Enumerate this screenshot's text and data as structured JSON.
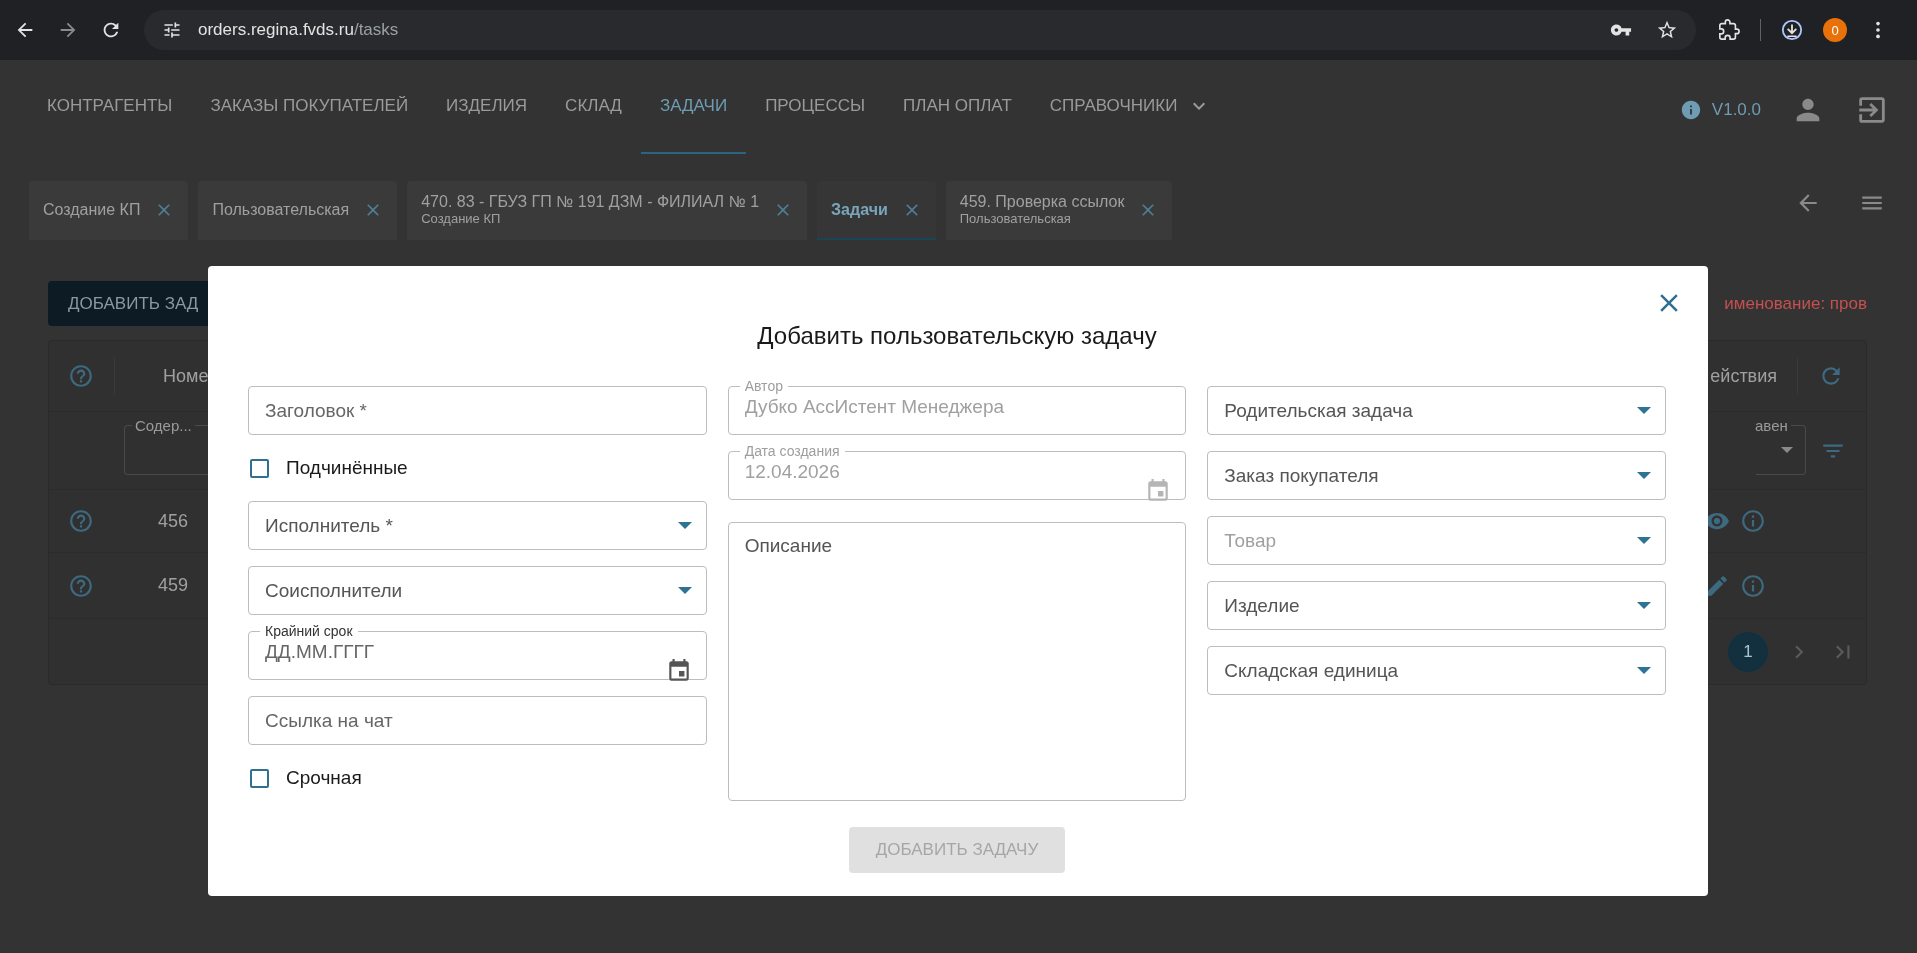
{
  "browser": {
    "url_host": "orders.regina.fvds.ru",
    "url_path": "/tasks",
    "profile": "0"
  },
  "nav": {
    "items": [
      {
        "label": "КОНТРАГЕНТЫ",
        "selected": false,
        "kind": "link"
      },
      {
        "label": "ЗАКАЗЫ ПОКУПАТЕЛЕЙ",
        "selected": false,
        "kind": "link"
      },
      {
        "label": "ИЗДЕЛИЯ",
        "selected": false,
        "kind": "link"
      },
      {
        "label": "СКЛАД",
        "selected": false,
        "kind": "link"
      },
      {
        "label": "ЗАДАЧИ",
        "selected": true,
        "kind": "link"
      },
      {
        "label": "ПРОЦЕССЫ",
        "selected": false,
        "kind": "link"
      },
      {
        "label": "ПЛАН ОПЛАТ",
        "selected": false,
        "kind": "link"
      },
      {
        "label": "СПРАВОЧНИКИ",
        "selected": false,
        "kind": "menu"
      }
    ],
    "version": "V1.0.0"
  },
  "tabs": [
    {
      "title": "Создание КП",
      "selected": false
    },
    {
      "title": "Пользовательская",
      "selected": false
    },
    {
      "title": "470. 83 - ГБУЗ ГП № 191 ДЗМ - ФИЛИАЛ № 1",
      "subtitle": "Создание КП",
      "selected": false
    },
    {
      "title": "Задачи",
      "selected": true
    },
    {
      "title": "459. Проверка ссылок",
      "subtitle": "Пользовательская",
      "selected": false
    }
  ],
  "page": {
    "add_button": "ДОБАВИТЬ ЗАД",
    "filter_note": "именование: пров",
    "table": {
      "columns": [
        "Номе",
        "ействия"
      ],
      "filters": [
        "Содер...",
        "авен"
      ],
      "rows": [
        {
          "number": "456",
          "kind": "view"
        },
        {
          "number": "459",
          "kind": "edit"
        }
      ],
      "pages": [
        {
          "label": "1",
          "selected": true
        }
      ]
    }
  },
  "dialog": {
    "title": "Добавить пользовательскую задачу",
    "columns": [
      [
        {
          "kind": "text",
          "placeholder": "Заголовок *",
          "disabled": false
        },
        {
          "kind": "checkbox",
          "label": "Подчинённые",
          "checked": false
        },
        {
          "kind": "select",
          "placeholder": "Исполнитель *",
          "disabled": false
        },
        {
          "kind": "select",
          "placeholder": "Соисполнители",
          "disabled": false
        },
        {
          "kind": "date",
          "label": "Крайний срок",
          "placeholder": "ДД.ММ.ГГГГ",
          "disabled": false
        },
        {
          "kind": "text",
          "placeholder": "Ссылка на чат",
          "disabled": false
        },
        {
          "kind": "checkbox",
          "label": "Срочная",
          "checked": false
        }
      ],
      [
        {
          "kind": "text",
          "label": "Автор",
          "value": "Дубко АссИстент Менеджера",
          "disabled": true
        },
        {
          "kind": "date",
          "label": "Дата создания",
          "value": "12.04.2026",
          "disabled": true
        },
        {
          "kind": "textarea",
          "placeholder": "Описание"
        }
      ],
      [
        {
          "kind": "select",
          "placeholder": "Родительская задача",
          "disabled": false
        },
        {
          "kind": "select",
          "placeholder": "Заказ покупателя",
          "disabled": false
        },
        {
          "kind": "select",
          "placeholder": "Товар",
          "disabled": true
        },
        {
          "kind": "select",
          "placeholder": "Изделие",
          "disabled": false
        },
        {
          "kind": "select",
          "placeholder": "Складская единица",
          "disabled": false
        }
      ]
    ],
    "submit": {
      "label": "ДОБАВИТЬ ЗАДАЧУ",
      "disabled": true
    }
  }
}
